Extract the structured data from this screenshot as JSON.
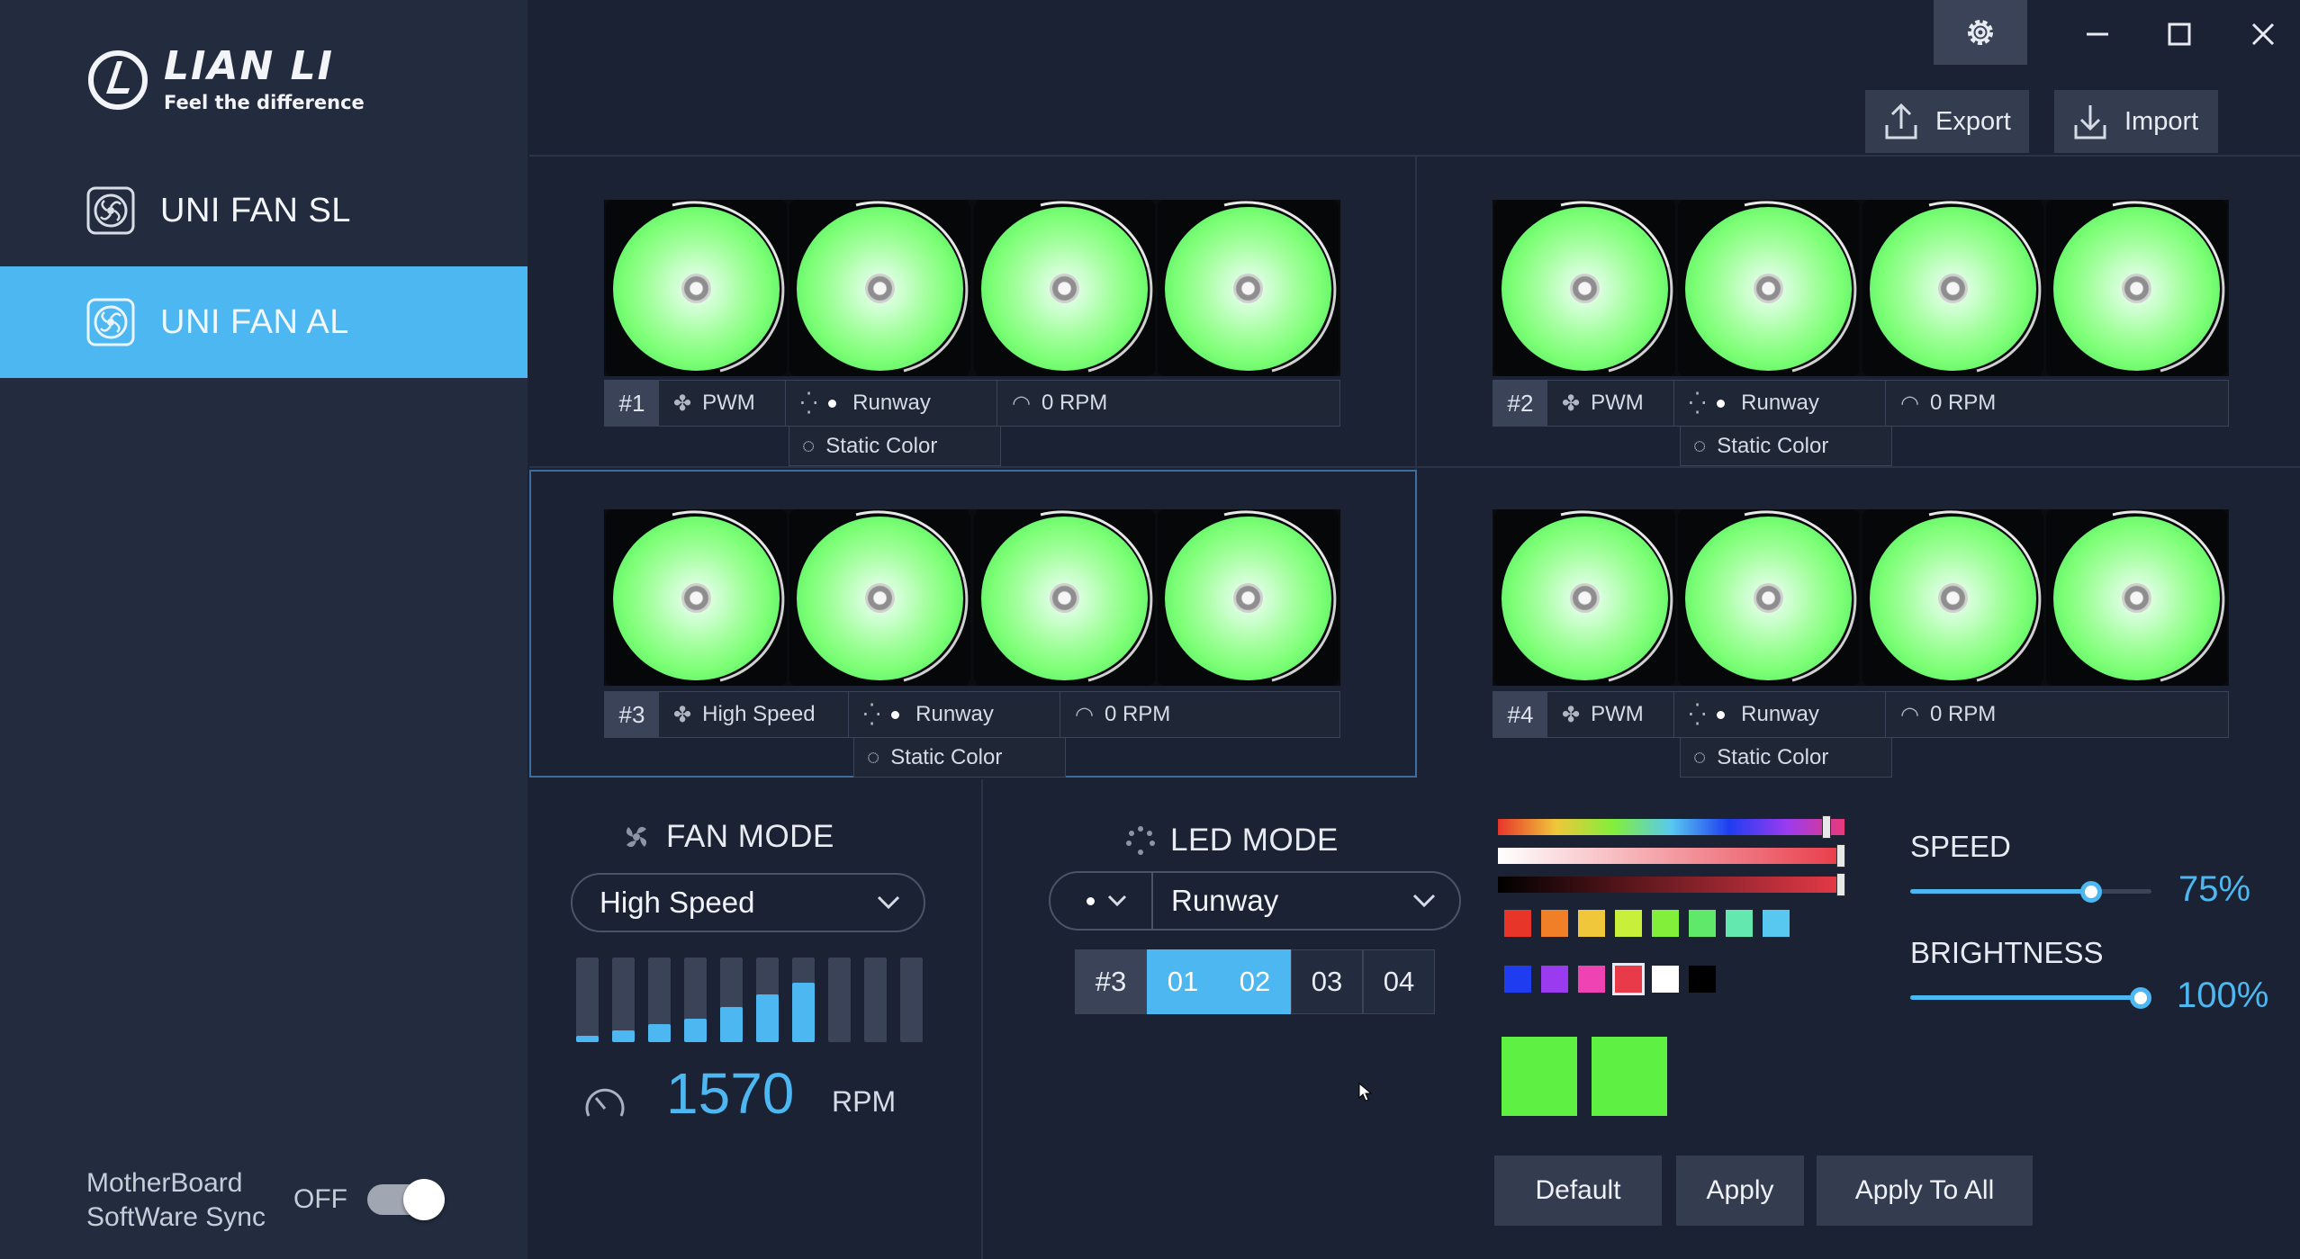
{
  "brand": {
    "title": "LIAN LI",
    "tagline": "Feel the difference"
  },
  "sidebar": {
    "items": [
      {
        "label": "UNI FAN SL",
        "icon": "fan-icon",
        "active": false
      },
      {
        "label": "UNI FAN AL",
        "icon": "fan-icon",
        "active": true
      }
    ],
    "sync": {
      "line1": "MotherBoard",
      "line2": "SoftWare Sync",
      "state": "OFF"
    }
  },
  "toolbar": {
    "export_label": "Export",
    "import_label": "Import"
  },
  "groups": [
    {
      "id": "#1",
      "fan_mode": "PWM",
      "led_mode": "Runway",
      "led_sub": "Static Color",
      "rpm": "0 RPM"
    },
    {
      "id": "#2",
      "fan_mode": "PWM",
      "led_mode": "Runway",
      "led_sub": "Static Color",
      "rpm": "0 RPM"
    },
    {
      "id": "#3",
      "fan_mode": "High Speed",
      "led_mode": "Runway",
      "led_sub": "Static Color",
      "rpm": "0 RPM"
    },
    {
      "id": "#4",
      "fan_mode": "PWM",
      "led_mode": "Runway",
      "led_sub": "Static Color",
      "rpm": "0 RPM"
    }
  ],
  "fan_mode": {
    "title": "FAN MODE",
    "selected": "High Speed",
    "rpm_value": "1570",
    "rpm_unit": "RPM",
    "bar_levels": [
      0.07,
      0.14,
      0.21,
      0.28,
      0.42,
      0.56,
      0.7,
      0,
      0,
      0
    ]
  },
  "led_mode": {
    "title": "LED MODE",
    "selected": "Runway",
    "zones": {
      "group": "#3",
      "items": [
        "01",
        "02",
        "03",
        "04"
      ],
      "selected": [
        "01",
        "02"
      ]
    }
  },
  "colors": {
    "accent": "#4cb7f0",
    "row1": [
      "#e8352a",
      "#f07f27",
      "#f0c63a",
      "#c8f03a",
      "#82ef3b",
      "#5fe86a",
      "#63e8b0",
      "#59c8f0"
    ],
    "row2": [
      "#1f3cf0",
      "#9b3bf0",
      "#ef43b4",
      "#e83a48",
      "#ffffff",
      "#000000"
    ],
    "picked": "#e83a48",
    "preview": [
      "#5ef043",
      "#5ef043"
    ]
  },
  "speed": {
    "label": "SPEED",
    "value": "75%",
    "level": 0.75
  },
  "brightness": {
    "label": "BRIGHTNESS",
    "value": "100%",
    "level": 1.0
  },
  "actions": {
    "default_label": "Default",
    "apply_label": "Apply",
    "apply_all_label": "Apply To All"
  }
}
